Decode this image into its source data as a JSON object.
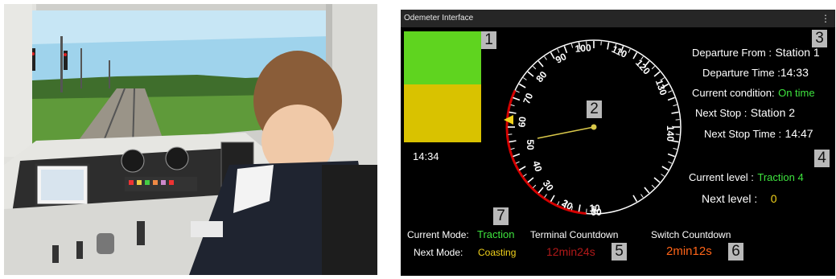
{
  "window": {
    "title": "Odemeter Interface",
    "menu_icon": "kebab-menu-icon"
  },
  "photo": {
    "description_icon": "train-driver-simulator-photo"
  },
  "markers": [
    "1",
    "2",
    "3",
    "4",
    "5",
    "6",
    "7"
  ],
  "status_blocks": {
    "top_color": "#5fd41f",
    "bottom_color": "#d9c200"
  },
  "clock": "14:34",
  "dial": {
    "labels": [
      "100",
      "90",
      "80",
      "70",
      "60",
      "50",
      "40",
      "30",
      "20",
      "10",
      "00",
      "110",
      "120",
      "130",
      "140"
    ],
    "needle_color": "#d9c84a",
    "arc_color": "#d40000",
    "pointer_color": "#f2d21b"
  },
  "trip": {
    "departure_from_label": "Departure From :",
    "departure_from_value": "Station 1",
    "departure_time_label": "Departure Time :",
    "departure_time_value": "14:33",
    "condition_label": "Current condition:",
    "condition_value": "On time",
    "next_stop_label": "Next Stop :",
    "next_stop_value": "Station 2",
    "next_stop_time_label": "Next Stop Time :",
    "next_stop_time_value": "14:47"
  },
  "levels": {
    "current_label": "Current level :",
    "current_value": "Traction 4",
    "next_label": "Next level :",
    "next_value": "0"
  },
  "modes": {
    "current_label": "Current Mode:",
    "current_value": "Traction",
    "next_label": "Next Mode:",
    "next_value": "Coasting"
  },
  "countdowns": {
    "terminal_label": "Terminal Countdown",
    "terminal_value": "12min24s",
    "switch_label": "Switch Countdown",
    "switch_value": "2min12s"
  }
}
